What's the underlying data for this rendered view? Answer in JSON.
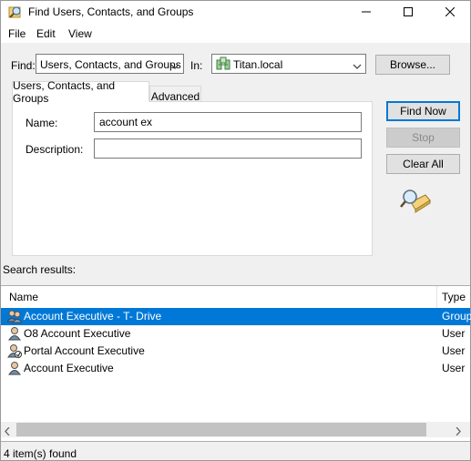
{
  "window": {
    "title": "Find Users, Contacts, and Groups",
    "icon": "find-people-icon"
  },
  "menu": [
    "File",
    "Edit",
    "View"
  ],
  "find": {
    "find_label": "Find:",
    "find_value": "Users, Contacts, and Groups",
    "in_label": "In:",
    "in_value": "Titan.local",
    "in_icon": "domain-icon",
    "browse_label": "Browse..."
  },
  "tabs": [
    {
      "label": "Users, Contacts, and Groups",
      "active": true
    },
    {
      "label": "Advanced",
      "active": false
    }
  ],
  "form": {
    "name_label": "Name:",
    "name_value": "account ex",
    "description_label": "Description:",
    "description_value": ""
  },
  "actions": {
    "find_now": "Find Now",
    "stop": "Stop",
    "clear_all": "Clear All",
    "search_icon": "magnifier-search-icon"
  },
  "results": {
    "label": "Search results:",
    "columns": [
      "Name",
      "Type"
    ],
    "rows": [
      {
        "name": "Account Executive - T- Drive",
        "type": "Group",
        "icon": "group-icon",
        "selected": true
      },
      {
        "name": "O8 Account Executive",
        "type": "User",
        "icon": "user-icon",
        "selected": false
      },
      {
        "name": "Portal Account Executive",
        "type": "User",
        "icon": "user-disabled-icon",
        "selected": false
      },
      {
        "name": "Account Executive",
        "type": "User",
        "icon": "user-icon",
        "selected": false
      }
    ]
  },
  "status": "4 item(s) found",
  "colors": {
    "selection": "#0078d7",
    "default_button_border": "#0078d7"
  }
}
